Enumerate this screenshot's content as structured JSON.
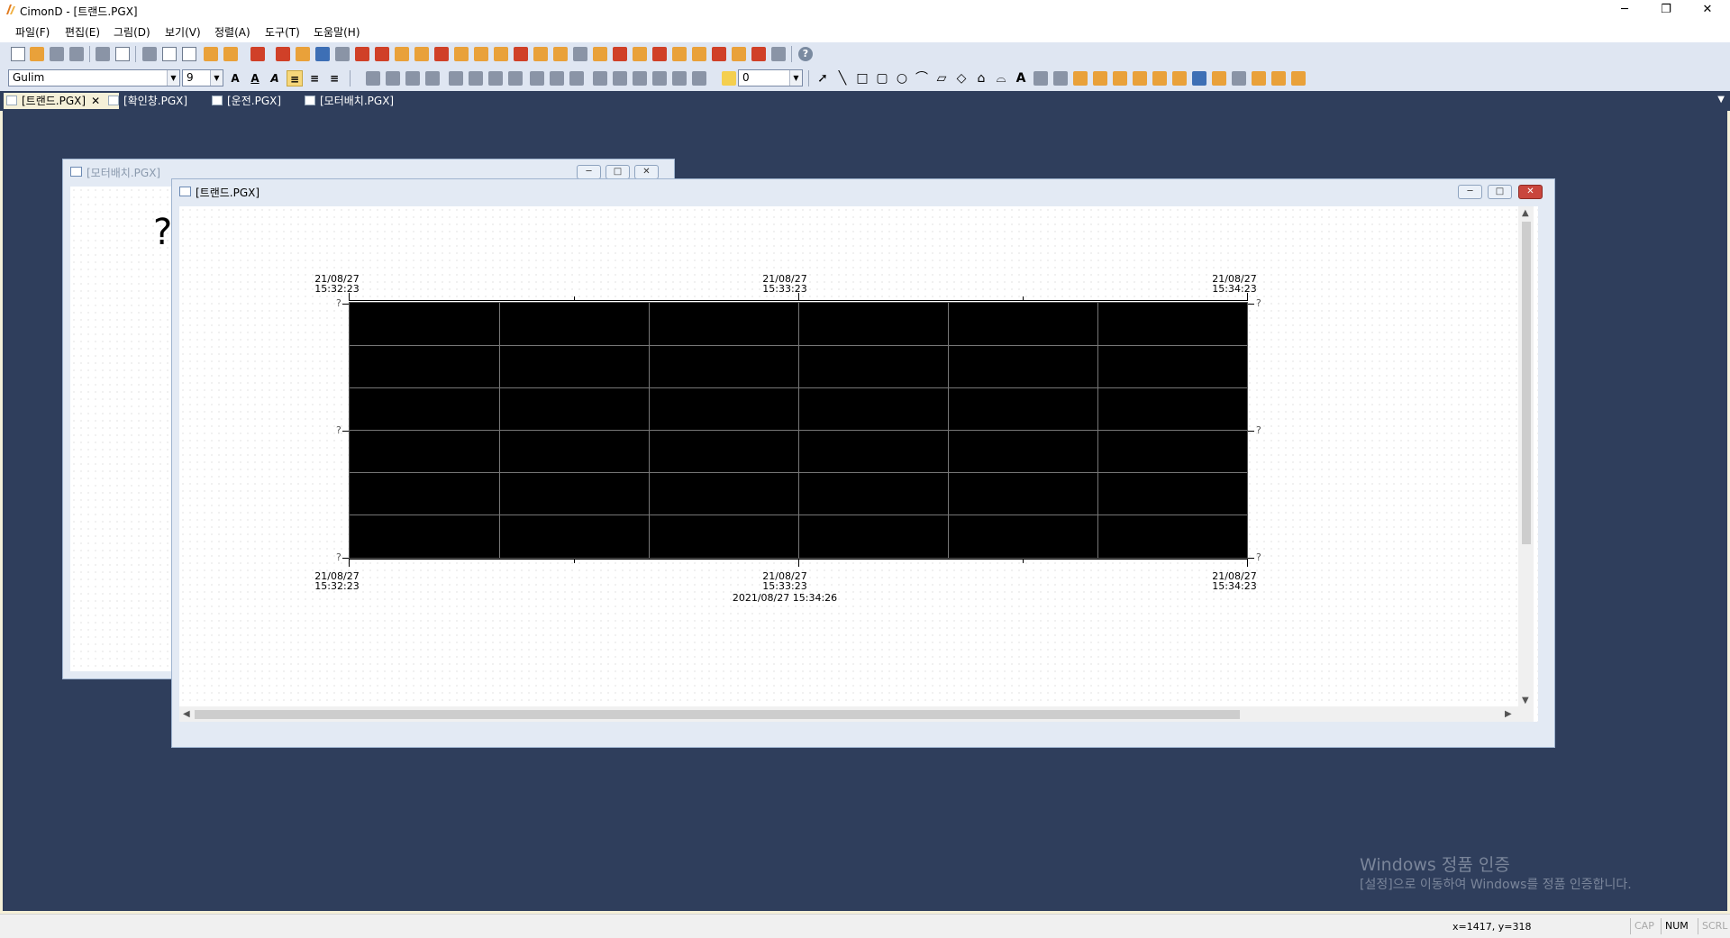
{
  "app": {
    "title": "CimonD - [트랜드.PGX]",
    "window_controls": {
      "minimize": "─",
      "restore": "❐",
      "close": "✕"
    }
  },
  "menu": [
    "파일(F)",
    "편집(E)",
    "그림(D)",
    "보기(V)",
    "정렬(A)",
    "도구(T)",
    "도움말(H)"
  ],
  "toolbar": {
    "font_name": "Gulim",
    "font_size": "9",
    "format_buttons": [
      "A",
      "A",
      "A",
      "≡",
      "≡",
      "≡"
    ],
    "line_width": "0",
    "text_tool": "A"
  },
  "tabs": [
    {
      "label": "[트랜드.PGX]",
      "active": true,
      "close": "✕"
    },
    {
      "label": "[확인창.PGX]",
      "active": false
    },
    {
      "label": "[운전.PGX]",
      "active": false
    },
    {
      "label": "[모터배치.PGX]",
      "active": false
    }
  ],
  "tab_menu_icon": "chevron-down-icon",
  "windows": {
    "motor": {
      "title": "[모터배치.PGX]",
      "placeholder": "?"
    },
    "trend": {
      "title": "[트랜드.PGX]"
    }
  },
  "trend": {
    "top_times": [
      {
        "date": "21/08/27",
        "time": "15:32:23"
      },
      {
        "date": "21/08/27",
        "time": "15:33:23"
      },
      {
        "date": "21/08/27",
        "time": "15:34:23"
      }
    ],
    "bottom_times": [
      {
        "date": "21/08/27",
        "time": "15:32:23"
      },
      {
        "date": "21/08/27",
        "time": "15:33:23"
      },
      {
        "date": "21/08/27",
        "time": "15:34:23"
      }
    ],
    "current_time": "2021/08/27 15:34:26",
    "y_labels": [
      "?",
      "?",
      "?"
    ],
    "grid": {
      "vertical_lines": 5,
      "horizontal_lines": 5
    }
  },
  "watermark": {
    "line1": "Windows 정품 인증",
    "line2": "[설정]으로 이동하여 Windows를 정품 인증합니다."
  },
  "status": {
    "coords": "x=1417, y=318",
    "cap": "CAP",
    "num": "NUM",
    "scrl": "SCRL"
  }
}
